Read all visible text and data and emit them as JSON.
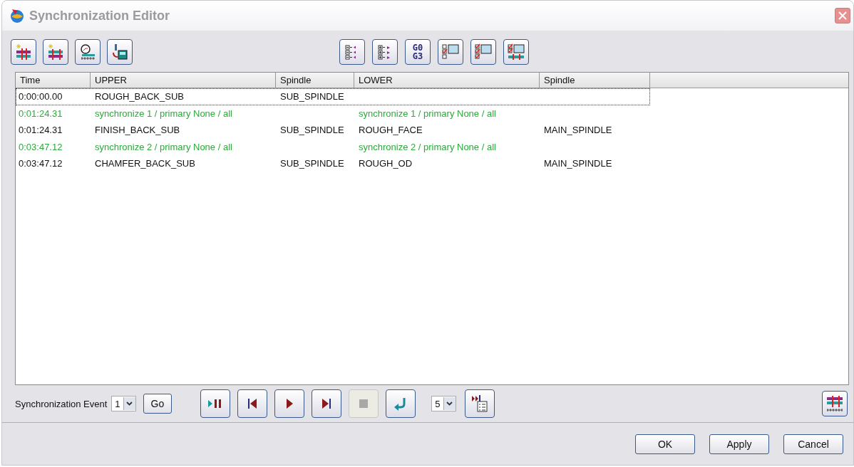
{
  "window": {
    "title": "Synchronization Editor"
  },
  "toolbar": {
    "code_button": [
      "G0",
      "G3"
    ]
  },
  "table": {
    "columns": [
      "Time",
      "UPPER",
      "Spindle",
      "LOWER",
      "Spindle"
    ],
    "rows": [
      {
        "kind": "operation",
        "selected": true,
        "cells": [
          "0:00:00.00",
          "ROUGH_BACK_SUB",
          "SUB_SPINDLE",
          "",
          ""
        ]
      },
      {
        "kind": "sync",
        "selected": false,
        "cells": [
          "0:01:24.31",
          "synchronize 1 / primary None / all",
          "",
          "synchronize 1 / primary None / all",
          ""
        ]
      },
      {
        "kind": "operation",
        "selected": false,
        "cells": [
          "0:01:24.31",
          "FINISH_BACK_SUB",
          "SUB_SPINDLE",
          "ROUGH_FACE",
          "MAIN_SPINDLE"
        ]
      },
      {
        "kind": "sync",
        "selected": false,
        "cells": [
          "0:03:47.12",
          "synchronize 2 / primary None / all",
          "",
          "synchronize 2 / primary None / all",
          ""
        ]
      },
      {
        "kind": "operation",
        "selected": false,
        "cells": [
          "0:03:47.12",
          "CHAMFER_BACK_SUB",
          "SUB_SPINDLE",
          "ROUGH_OD",
          "MAIN_SPINDLE"
        ]
      }
    ]
  },
  "event": {
    "label": "Synchronization Event",
    "value": "1",
    "go": "Go"
  },
  "playback_buttons": [
    {
      "kind": "play-pause",
      "disabled": false
    },
    {
      "kind": "first",
      "disabled": false
    },
    {
      "kind": "play",
      "disabled": false
    },
    {
      "kind": "last",
      "disabled": false
    },
    {
      "kind": "stop",
      "disabled": true
    },
    {
      "kind": "return",
      "disabled": false
    }
  ],
  "step": {
    "value": "5"
  },
  "buttons": [
    "OK",
    "Apply",
    "Cancel"
  ]
}
